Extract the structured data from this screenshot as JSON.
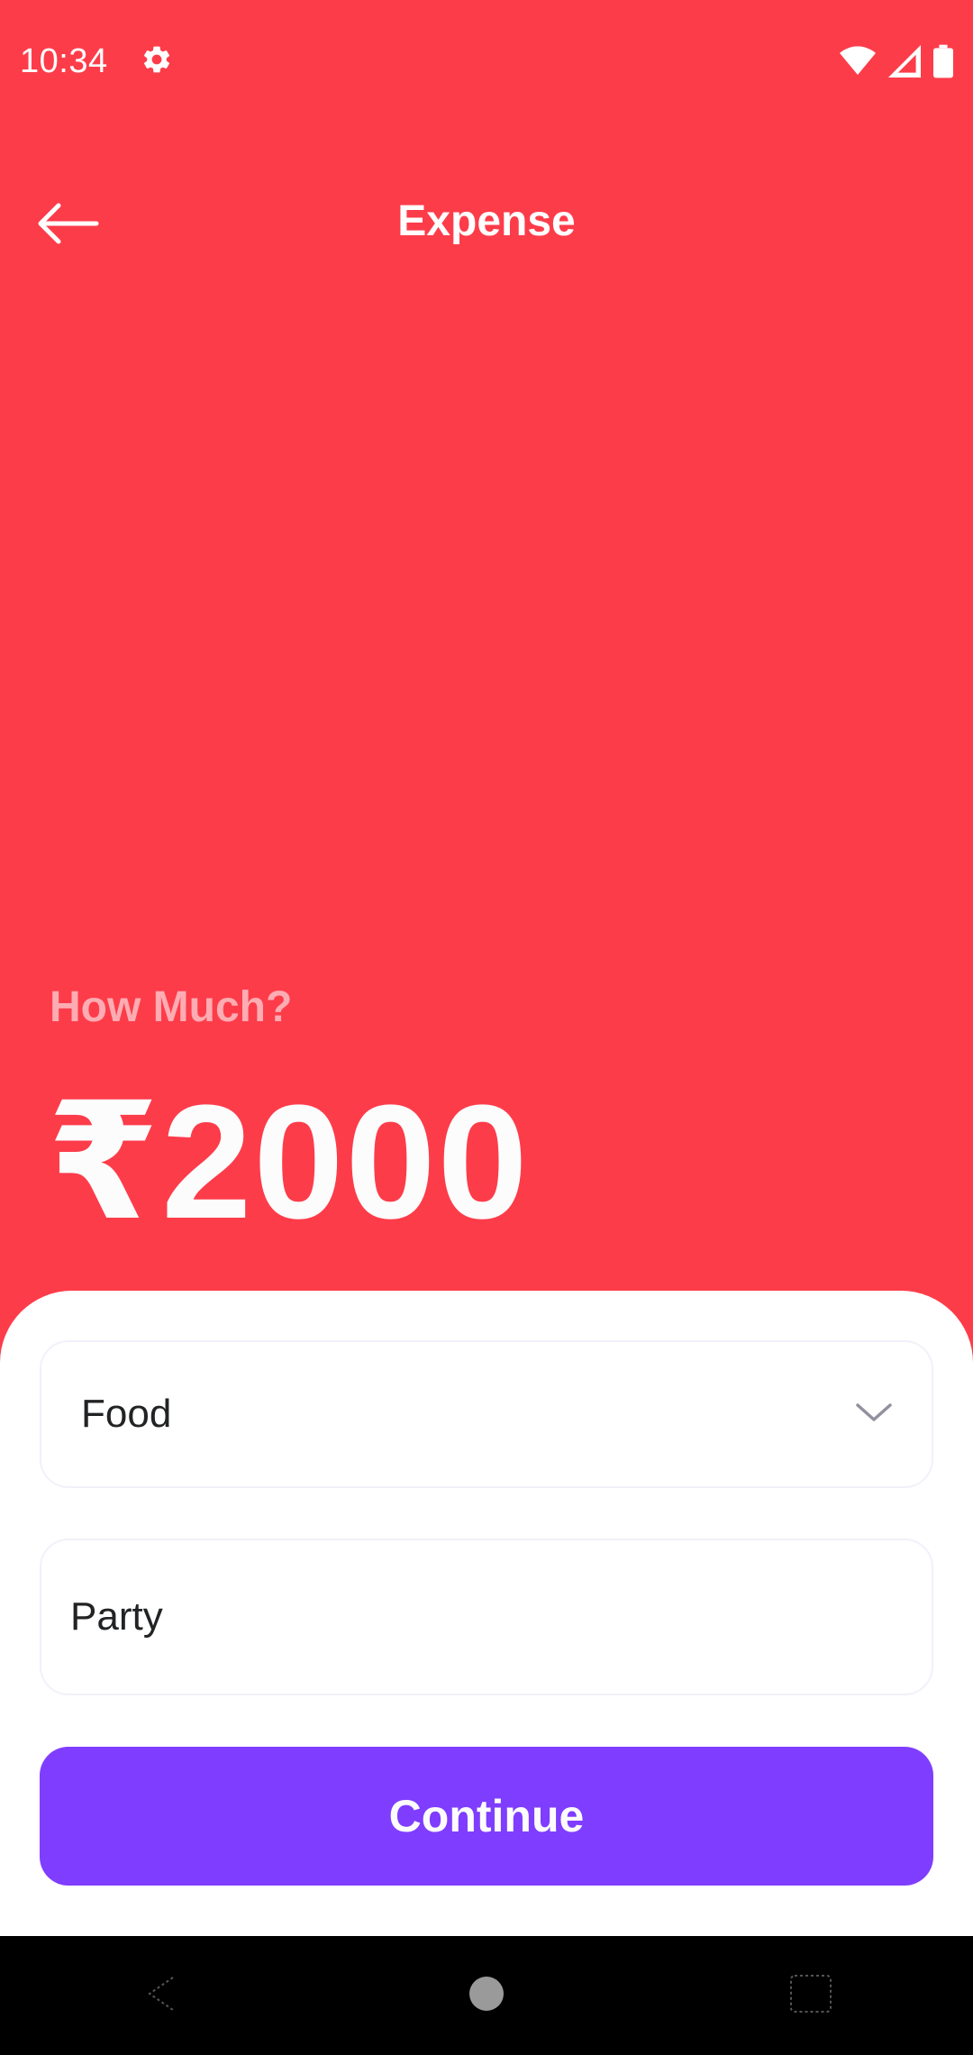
{
  "status_bar": {
    "time": "10:34",
    "icons": [
      "gear-icon",
      "wifi-icon",
      "cell-signal-icon",
      "battery-icon"
    ]
  },
  "header": {
    "title": "Expense",
    "back_icon": "arrow-left-icon"
  },
  "amount_section": {
    "prompt": "How Much?",
    "amount": "₹2000"
  },
  "form": {
    "category": {
      "value": "Food",
      "icon": "chevron-down-icon"
    },
    "description": {
      "value": "Party"
    },
    "continue_label": "Continue"
  },
  "nav_bar": {
    "items": [
      "back-nav-icon",
      "home-nav-icon",
      "recents-nav-icon"
    ]
  },
  "colors": {
    "background": "#FD3C4A",
    "prompt_text": "#FCACB2",
    "primary_button": "#7F3DFF",
    "sheet": "#FFFFFF",
    "field_border": "#F1F1FA"
  }
}
